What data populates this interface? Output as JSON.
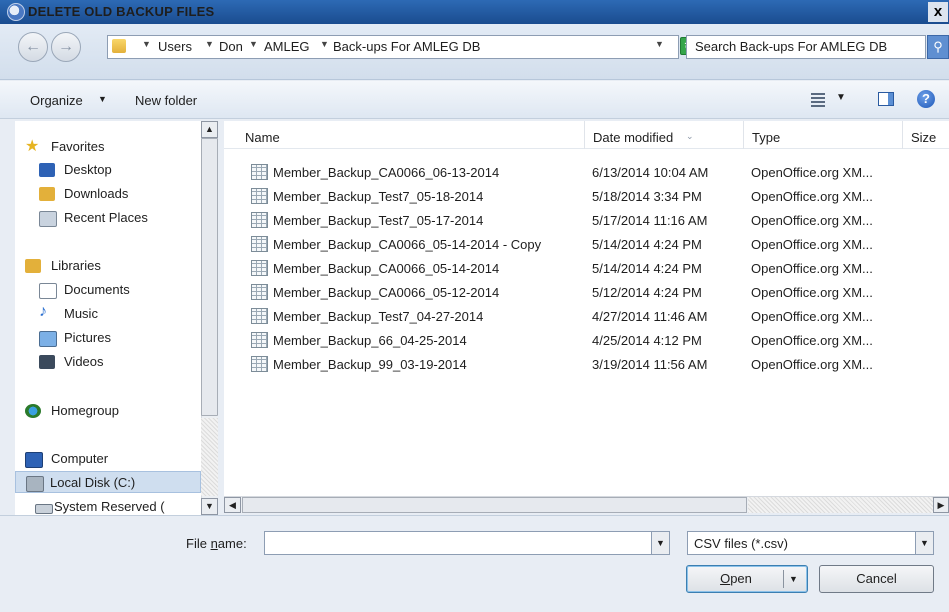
{
  "window": {
    "title": "DELETE OLD BACKUP FILES",
    "close_glyph": "x"
  },
  "address": {
    "crumbs": [
      "Users",
      "Don",
      "AMLEG",
      "Back-ups For AMLEG DB"
    ],
    "search_placeholder": "Search Back-ups For AMLEG DB"
  },
  "toolbar": {
    "organize": "Organize",
    "new_folder": "New folder",
    "help_glyph": "?"
  },
  "nav": {
    "favorites": "Favorites",
    "desktop": "Desktop",
    "downloads": "Downloads",
    "recent": "Recent Places",
    "libraries": "Libraries",
    "documents": "Documents",
    "music": "Music",
    "pictures": "Pictures",
    "videos": "Videos",
    "homegroup": "Homegroup",
    "computer": "Computer",
    "local_disk": "Local Disk (C:)",
    "system_reserved": "System Reserved ("
  },
  "columns": {
    "name": "Name",
    "date": "Date modified",
    "type": "Type",
    "size": "Size"
  },
  "files": [
    {
      "name": "Member_Backup_CA0066_06-13-2014",
      "date": "6/13/2014 10:04 AM",
      "type": "OpenOffice.org XM..."
    },
    {
      "name": "Member_Backup_Test7_05-18-2014",
      "date": "5/18/2014 3:34 PM",
      "type": "OpenOffice.org XM..."
    },
    {
      "name": "Member_Backup_Test7_05-17-2014",
      "date": "5/17/2014 11:16 AM",
      "type": "OpenOffice.org XM..."
    },
    {
      "name": "Member_Backup_CA0066_05-14-2014 - Copy",
      "date": "5/14/2014 4:24 PM",
      "type": "OpenOffice.org XM..."
    },
    {
      "name": "Member_Backup_CA0066_05-14-2014",
      "date": "5/14/2014 4:24 PM",
      "type": "OpenOffice.org XM..."
    },
    {
      "name": "Member_Backup_CA0066_05-12-2014",
      "date": "5/12/2014 4:24 PM",
      "type": "OpenOffice.org XM..."
    },
    {
      "name": "Member_Backup_Test7_04-27-2014",
      "date": "4/27/2014 11:46 AM",
      "type": "OpenOffice.org XM..."
    },
    {
      "name": "Member_Backup_66_04-25-2014",
      "date": "4/25/2014 4:12 PM",
      "type": "OpenOffice.org XM..."
    },
    {
      "name": "Member_Backup_99_03-19-2014",
      "date": "3/19/2014 11:56 AM",
      "type": "OpenOffice.org XM..."
    }
  ],
  "bottom": {
    "file_name_label_pre": "File ",
    "file_name_label_u": "n",
    "file_name_label_post": "ame:",
    "file_name_value": "",
    "filter": "CSV files (*.csv)",
    "open_u": "O",
    "open_rest": "pen",
    "cancel": "Cancel"
  }
}
